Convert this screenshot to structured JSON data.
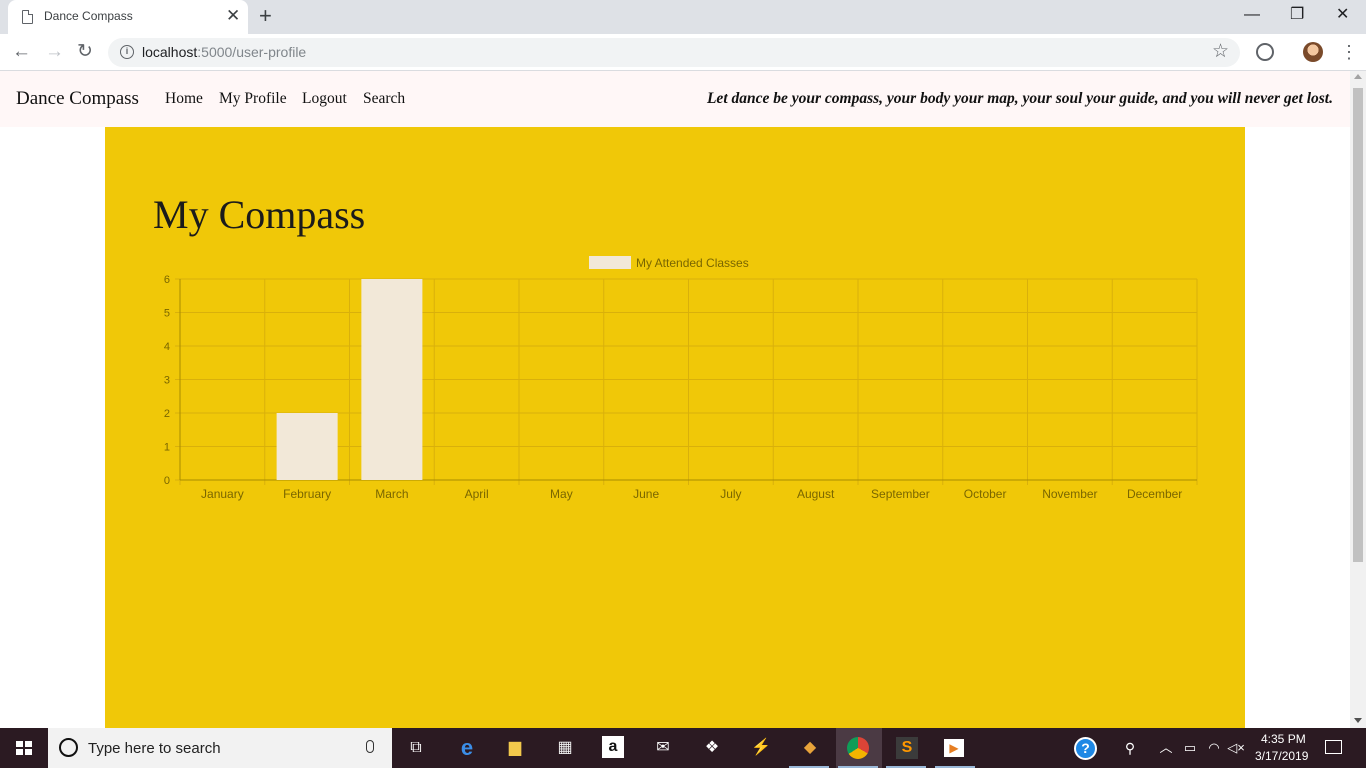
{
  "browser": {
    "tab_title": "Dance Compass",
    "url_host": "localhost",
    "url_path": ":5000/user-profile"
  },
  "navbar": {
    "brand": "Dance Compass",
    "links": [
      "Home",
      "My Profile",
      "Logout",
      "Search"
    ],
    "tagline": "Let dance be your compass, your body your map, your soul your guide, and you will never get lost."
  },
  "main": {
    "title": "My Compass"
  },
  "colors": {
    "panel": "#f0c808",
    "bar": "#f2e8d8",
    "grid": "#d9b00b",
    "text": "#7a6600"
  },
  "chart_data": {
    "type": "bar",
    "title": "",
    "categories": [
      "January",
      "February",
      "March",
      "April",
      "May",
      "June",
      "July",
      "August",
      "September",
      "October",
      "November",
      "December"
    ],
    "series": [
      {
        "name": "My Attended Classes",
        "values": [
          0,
          2,
          6,
          0,
          0,
          0,
          0,
          0,
          0,
          0,
          0,
          0
        ]
      }
    ],
    "xlabel": "",
    "ylabel": "",
    "ylim": [
      0,
      6
    ],
    "yticks": [
      0,
      1,
      2,
      3,
      4,
      5,
      6
    ],
    "grid": true,
    "legend": "top-center"
  },
  "taskbar": {
    "search_placeholder": "Type here to search",
    "time": "4:35 PM",
    "date": "3/17/2019"
  }
}
